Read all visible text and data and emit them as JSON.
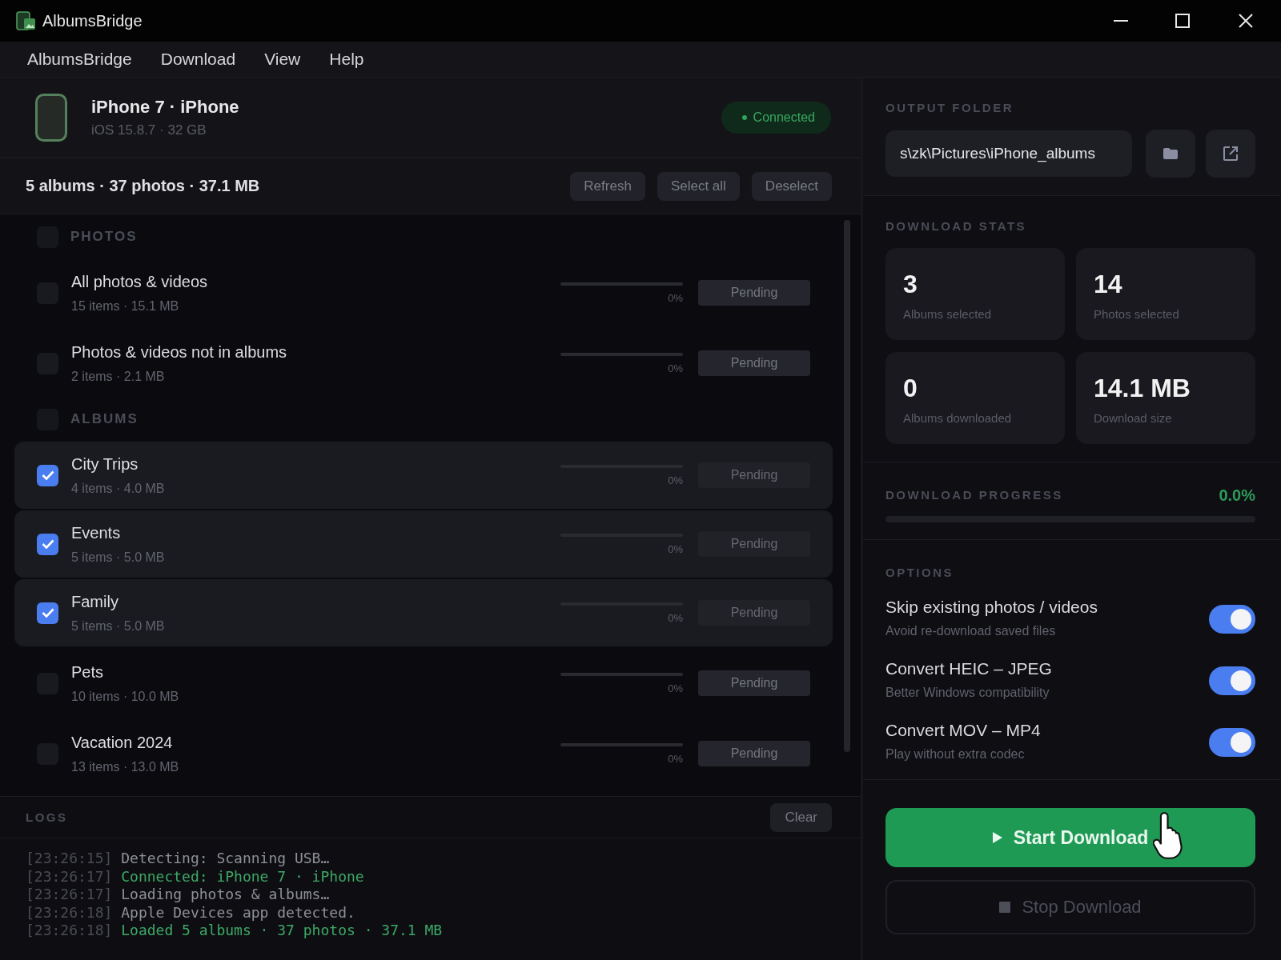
{
  "window": {
    "title": "AlbumsBridge"
  },
  "menu": [
    "AlbumsBridge",
    "Download",
    "View",
    "Help"
  ],
  "device": {
    "name": "iPhone 7 · iPhone",
    "details": "iOS 15.8.7 · 32 GB",
    "status": "Connected",
    "connected": true
  },
  "summary": {
    "text": "5 albums · 37 photos · 37.1 MB",
    "buttons": [
      "Refresh",
      "Select all",
      "Deselect"
    ]
  },
  "sections": [
    {
      "title": "PHOTOS",
      "checked": false,
      "items": [
        {
          "name": "All photos & videos",
          "details": "15 items · 15.1 MB",
          "checked": false,
          "level": 0,
          "percent": "0%",
          "status": "Pending"
        },
        {
          "name": "Photos & videos not in albums",
          "details": "2 items · 2.1 MB",
          "checked": false,
          "level": 0,
          "percent": "0%",
          "status": "Pending"
        }
      ]
    },
    {
      "title": "ALBUMS",
      "checked": false,
      "items": [
        {
          "name": "City Trips",
          "details": "4 items · 4.0 MB",
          "checked": true,
          "level": 0,
          "percent": "0%",
          "status": "Pending"
        },
        {
          "name": "Events",
          "details": "5 items · 5.0 MB",
          "checked": true,
          "level": 0,
          "percent": "0%",
          "status": "Pending"
        },
        {
          "name": "Family",
          "details": "5 items · 5.0 MB",
          "checked": true,
          "level": 0,
          "percent": "0%",
          "status": "Pending"
        },
        {
          "name": "Pets",
          "details": "10 items · 10.0 MB",
          "checked": false,
          "level": 0,
          "percent": "0%",
          "status": "Pending"
        },
        {
          "name": "Vacation 2024",
          "details": "13 items · 13.0 MB",
          "checked": false,
          "level": 0,
          "percent": "0%",
          "status": "Pending"
        }
      ]
    }
  ],
  "logs": {
    "title": "LOGS",
    "clear": "Clear",
    "lines": [
      {
        "time": "[23:26:15]",
        "message": "Detecting: Scanning USB…",
        "kind": "info"
      },
      {
        "time": "[23:26:17]",
        "message": "Connected: iPhone 7 · iPhone",
        "kind": "success"
      },
      {
        "time": "[23:26:17]",
        "message": "Loading photos & albums…",
        "kind": "info"
      },
      {
        "time": "[23:26:18]",
        "message": "Apple Devices app detected.",
        "kind": "info"
      },
      {
        "time": "[23:26:18]",
        "message": "Loaded 5 albums · 37 photos · 37.1 MB",
        "kind": "success"
      }
    ]
  },
  "output_folder": {
    "label": "OUTPUT FOLDER",
    "path": "s\\zk\\Pictures\\iPhone_albums"
  },
  "stats": {
    "label": "DOWNLOAD STATS",
    "cards": [
      {
        "value": "3",
        "label": "Albums selected"
      },
      {
        "value": "14",
        "label": "Photos selected"
      },
      {
        "value": "0",
        "label": "Albums downloaded"
      },
      {
        "value": "14.1 MB",
        "label": "Download size"
      }
    ]
  },
  "progress": {
    "label": "DOWNLOAD PROGRESS",
    "reading": "0.0%",
    "level": 0
  },
  "options": {
    "label": "OPTIONS",
    "items": [
      {
        "title": "Skip existing photos / videos",
        "description": "Avoid re-download saved files",
        "on": true
      },
      {
        "title": "Convert HEIC – JPEG",
        "description": "Better Windows compatibility",
        "on": true
      },
      {
        "title": "Convert MOV – MP4",
        "description": "Play without extra codec",
        "on": true
      }
    ]
  },
  "actions": [
    {
      "label": "Start Download",
      "kind": "start",
      "disabled": false
    },
    {
      "label": "Stop Download",
      "kind": "stop",
      "disabled": true
    }
  ]
}
